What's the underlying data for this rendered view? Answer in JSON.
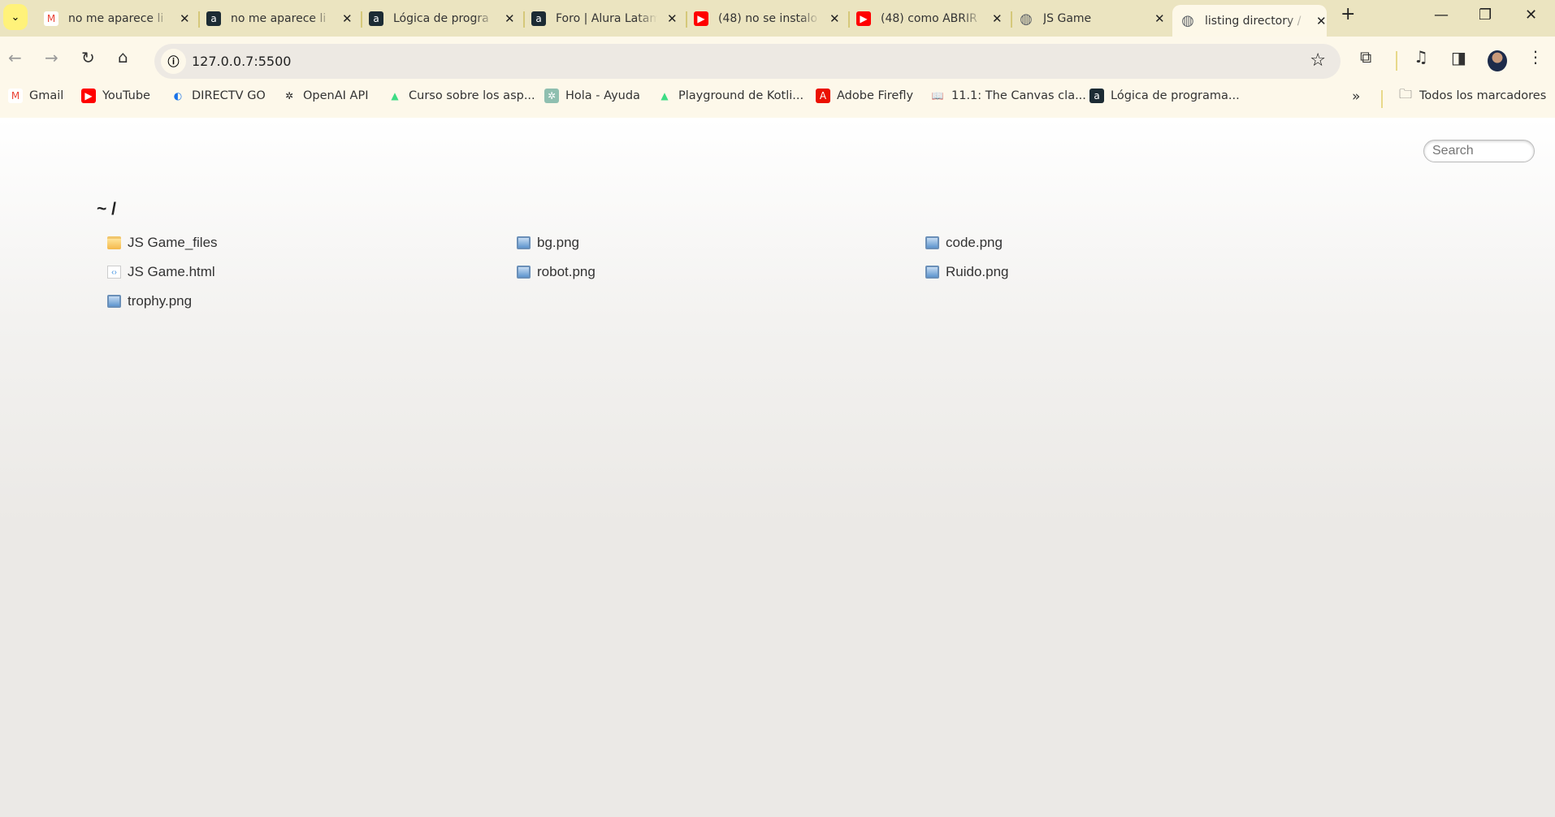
{
  "browser": {
    "tabs": [
      {
        "title": "no me aparece li",
        "icon": "gmail-icon",
        "color": "#ea4335"
      },
      {
        "title": "no me aparece li",
        "icon": "alura-icon",
        "color": "#1c2b34"
      },
      {
        "title": "Lógica de progra",
        "icon": "alura-icon",
        "color": "#1c2b34"
      },
      {
        "title": "Foro | Alura Latam",
        "icon": "alura-icon",
        "color": "#1c2b34"
      },
      {
        "title": "(48) no se instalo",
        "icon": "youtube-icon",
        "color": "#ff0000"
      },
      {
        "title": "(48) como ABRIR",
        "icon": "youtube-icon",
        "color": "#ff0000"
      },
      {
        "title": "JS Game",
        "icon": "globe-icon",
        "color": "#5f6368"
      },
      {
        "title": "listing directory /",
        "icon": "globe-icon",
        "color": "#5f6368",
        "active": true
      }
    ],
    "url": "127.0.0.7:5500",
    "bookmarks": [
      {
        "label": "Gmail",
        "icon": "gmail-icon"
      },
      {
        "label": "YouTube",
        "icon": "youtube-icon"
      },
      {
        "label": "DIRECTV GO",
        "icon": "directv-icon"
      },
      {
        "label": "OpenAI API",
        "icon": "openai-icon"
      },
      {
        "label": "Curso sobre los asp...",
        "icon": "android-icon"
      },
      {
        "label": "Hola - Ayuda",
        "icon": "chatgpt-icon"
      },
      {
        "label": "Playground de Kotli...",
        "icon": "android-icon"
      },
      {
        "label": "Adobe Firefly",
        "icon": "adobe-icon"
      },
      {
        "label": "11.1: The Canvas cla...",
        "icon": "book-icon"
      },
      {
        "label": "Lógica de programa...",
        "icon": "alura-icon"
      }
    ],
    "all_bookmarks": "Todos los marcadores"
  },
  "page": {
    "search_placeholder": "Search",
    "breadcrumb": "~ /",
    "files": [
      {
        "name": "JS Game_files",
        "type": "folder"
      },
      {
        "name": "bg.png",
        "type": "image"
      },
      {
        "name": "code.png",
        "type": "image"
      },
      {
        "name": "JS Game.html",
        "type": "html"
      },
      {
        "name": "robot.png",
        "type": "image"
      },
      {
        "name": "Ruido.png",
        "type": "image"
      },
      {
        "name": "trophy.png",
        "type": "image"
      }
    ]
  }
}
